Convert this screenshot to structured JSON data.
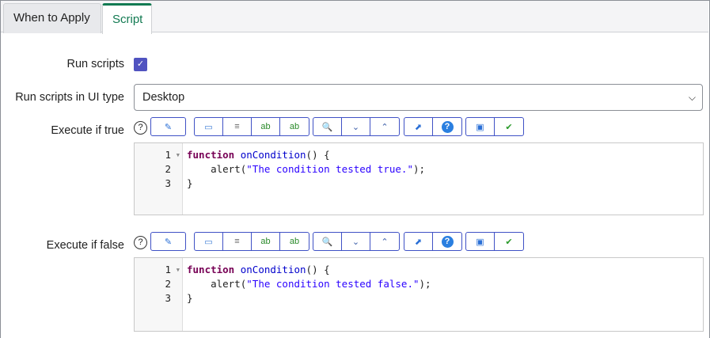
{
  "tabs": [
    {
      "label": "When to Apply",
      "active": false
    },
    {
      "label": "Script",
      "active": true
    }
  ],
  "run_scripts": {
    "label": "Run scripts",
    "checked": true
  },
  "ui_type": {
    "label": "Run scripts in UI type",
    "value": "Desktop"
  },
  "toolbar_icons": [
    "script-assist-icon",
    "comment-icon",
    "format-icon",
    "replace-icon",
    "replace-all-icon",
    "search-icon",
    "next-icon",
    "previous-icon",
    "fullscreen-icon",
    "help-icon",
    "save-icon",
    "syntax-check-icon"
  ],
  "true_script": {
    "label": "Execute if true",
    "lines": [
      "1",
      "2",
      "3"
    ],
    "code": {
      "kw": "function",
      "fn": "onCondition",
      "rest1": "() {",
      "indent": "    alert(",
      "str": "\"The condition tested true.\"",
      "end": ");",
      "close": "}"
    }
  },
  "false_script": {
    "label": "Execute if false",
    "lines": [
      "1",
      "2",
      "3"
    ],
    "code": {
      "kw": "function",
      "fn": "onCondition",
      "rest1": "() {",
      "indent": "    alert(",
      "str": "\"The condition tested false.\"",
      "end": ");",
      "close": "}"
    }
  },
  "colors": {
    "accent": "#127a52",
    "checkbox": "#5053c0",
    "button_border": "#3f51c5"
  }
}
